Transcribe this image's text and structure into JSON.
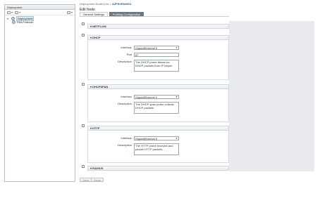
{
  "left_panel": {
    "title": "Deployment",
    "tree": [
      {
        "label": "Deployment",
        "selected": true
      },
      {
        "label": "PAN Failover",
        "selected": false
      }
    ]
  },
  "breadcrumb": {
    "path": "Deployment Nodes List >",
    "current": "A2PIKIPAN001"
  },
  "page_title": "Edit Node",
  "tabs": [
    {
      "label": "General Settings",
      "active": false
    },
    {
      "label": "Profiling Configuration",
      "active": true
    }
  ],
  "sections": {
    "netflow": {
      "title": "NETFLOW"
    },
    "dhcp": {
      "title": "DHCP",
      "interface_label": "Interface",
      "interface_value": "GigabitEthernet 0",
      "port_label": "Port",
      "port_value": "67",
      "description_label": "Description",
      "description_value": "The DHCP probe listens for DHCP packets from IP helper."
    },
    "dhcpspan": {
      "title": "DHCPSPAN",
      "interface_label": "Interface",
      "interface_value": "GigabitEthernet 0",
      "description_label": "Description",
      "description_value": "The DHCP span probe collects DHCP packets."
    },
    "http": {
      "title": "HTTP",
      "interface_label": "Interface",
      "interface_value": "GigabitEthernet 0",
      "description_label": "Description",
      "description_value": "The HTTP probe receives and parses HTTP packets."
    },
    "radius": {
      "title": "RADIUS"
    }
  },
  "footer": {
    "save_label": "Save",
    "reset_label": "Reset"
  }
}
